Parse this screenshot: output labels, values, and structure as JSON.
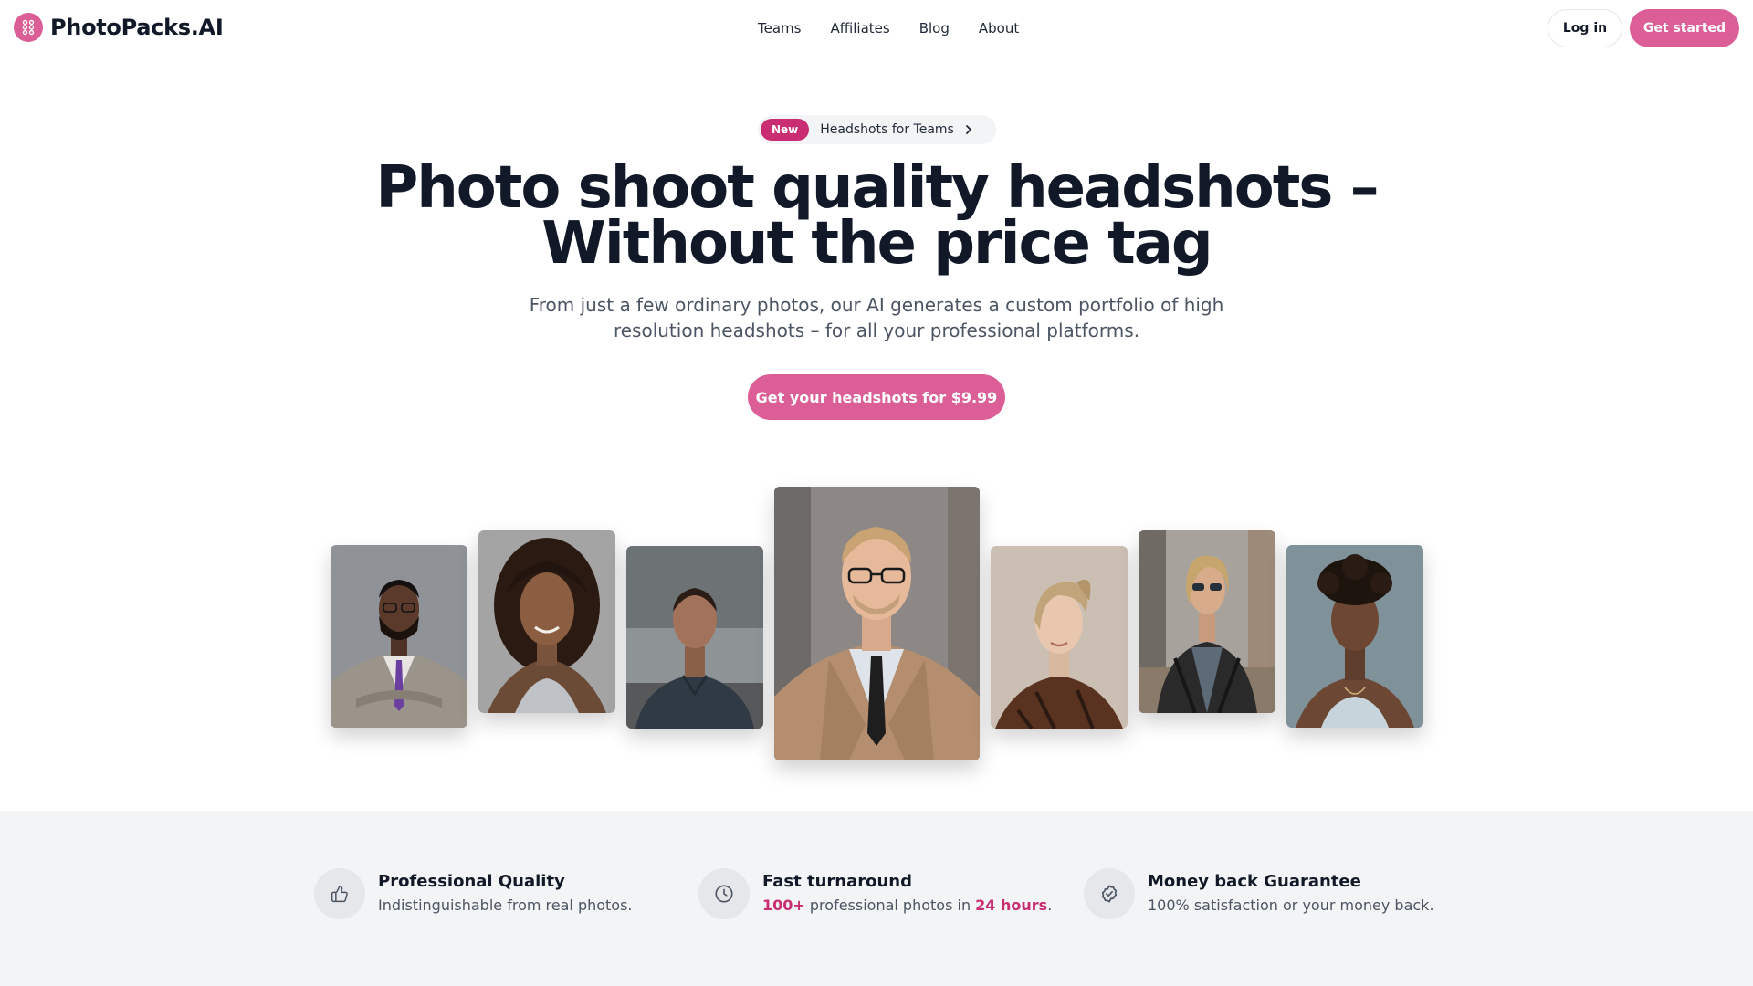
{
  "brand": {
    "name": "PhotoPacks.AI",
    "logo_icon": "dots-grid-icon",
    "accent": "#db5f96"
  },
  "nav": {
    "items": [
      "Teams",
      "Affiliates",
      "Blog",
      "About"
    ]
  },
  "header": {
    "login_label": "Log in",
    "start_label": "Get started"
  },
  "announce": {
    "badge": "New",
    "text": "Headshots for Teams"
  },
  "hero": {
    "title_line1": "Photo shoot quality headshots –",
    "title_line2": "Without the price tag",
    "subtitle": "From just a few ordinary photos, our AI generates a custom portfolio of high resolution headshots – for all your professional platforms.",
    "cta_label": "Get your headshots for $9.99"
  },
  "photos": [
    {
      "name": "headshot-man-gray-suit"
    },
    {
      "name": "headshot-woman-curly-hair"
    },
    {
      "name": "headshot-man-navy-polo"
    },
    {
      "name": "headshot-man-trench-coat"
    },
    {
      "name": "headshot-woman-short-hair"
    },
    {
      "name": "headshot-man-leather-jacket"
    },
    {
      "name": "headshot-woman-white-top"
    }
  ],
  "features": [
    {
      "icon": "thumbs-up-icon",
      "title": "Professional Quality",
      "desc": "Indistinguishable from real photos."
    },
    {
      "icon": "clock-icon",
      "title": "Fast turnaround",
      "desc_hl1": "100+",
      "desc_mid": " professional photos in ",
      "desc_hl2": "24 hours",
      "desc_end": "."
    },
    {
      "icon": "badge-check-icon",
      "title": "Money back Guarantee",
      "desc": "100% satisfaction or your money back."
    }
  ]
}
